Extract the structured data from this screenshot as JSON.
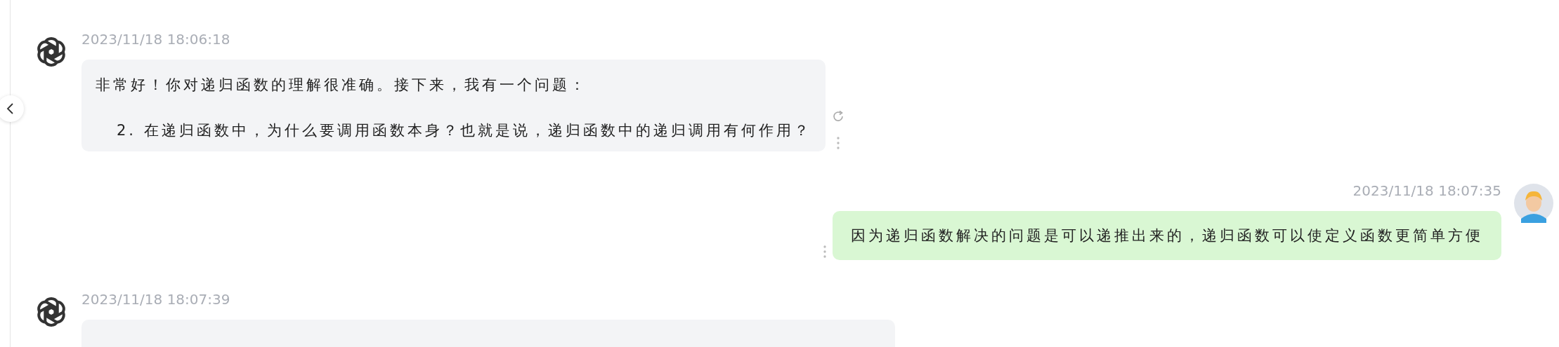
{
  "messages": [
    {
      "kind": "assistant",
      "time": "2023/11/18 18:06:18",
      "paragraphs": [
        "非常好！你对递归函数的理解很准确。接下来，我有一个问题：",
        "2. 在递归函数中，为什么要调用函数本身？也就是说，递归函数中的递归调用有何作用？"
      ],
      "actions": true
    },
    {
      "kind": "user",
      "time": "2023/11/18 18:07:35",
      "paragraphs": [
        "因为递归函数解决的问题是可以递推出来的，递归函数可以使定义函数更简单方便"
      ],
      "actions": true
    },
    {
      "kind": "assistant",
      "time": "2023/11/18 18:07:39",
      "actions": false
    }
  ]
}
